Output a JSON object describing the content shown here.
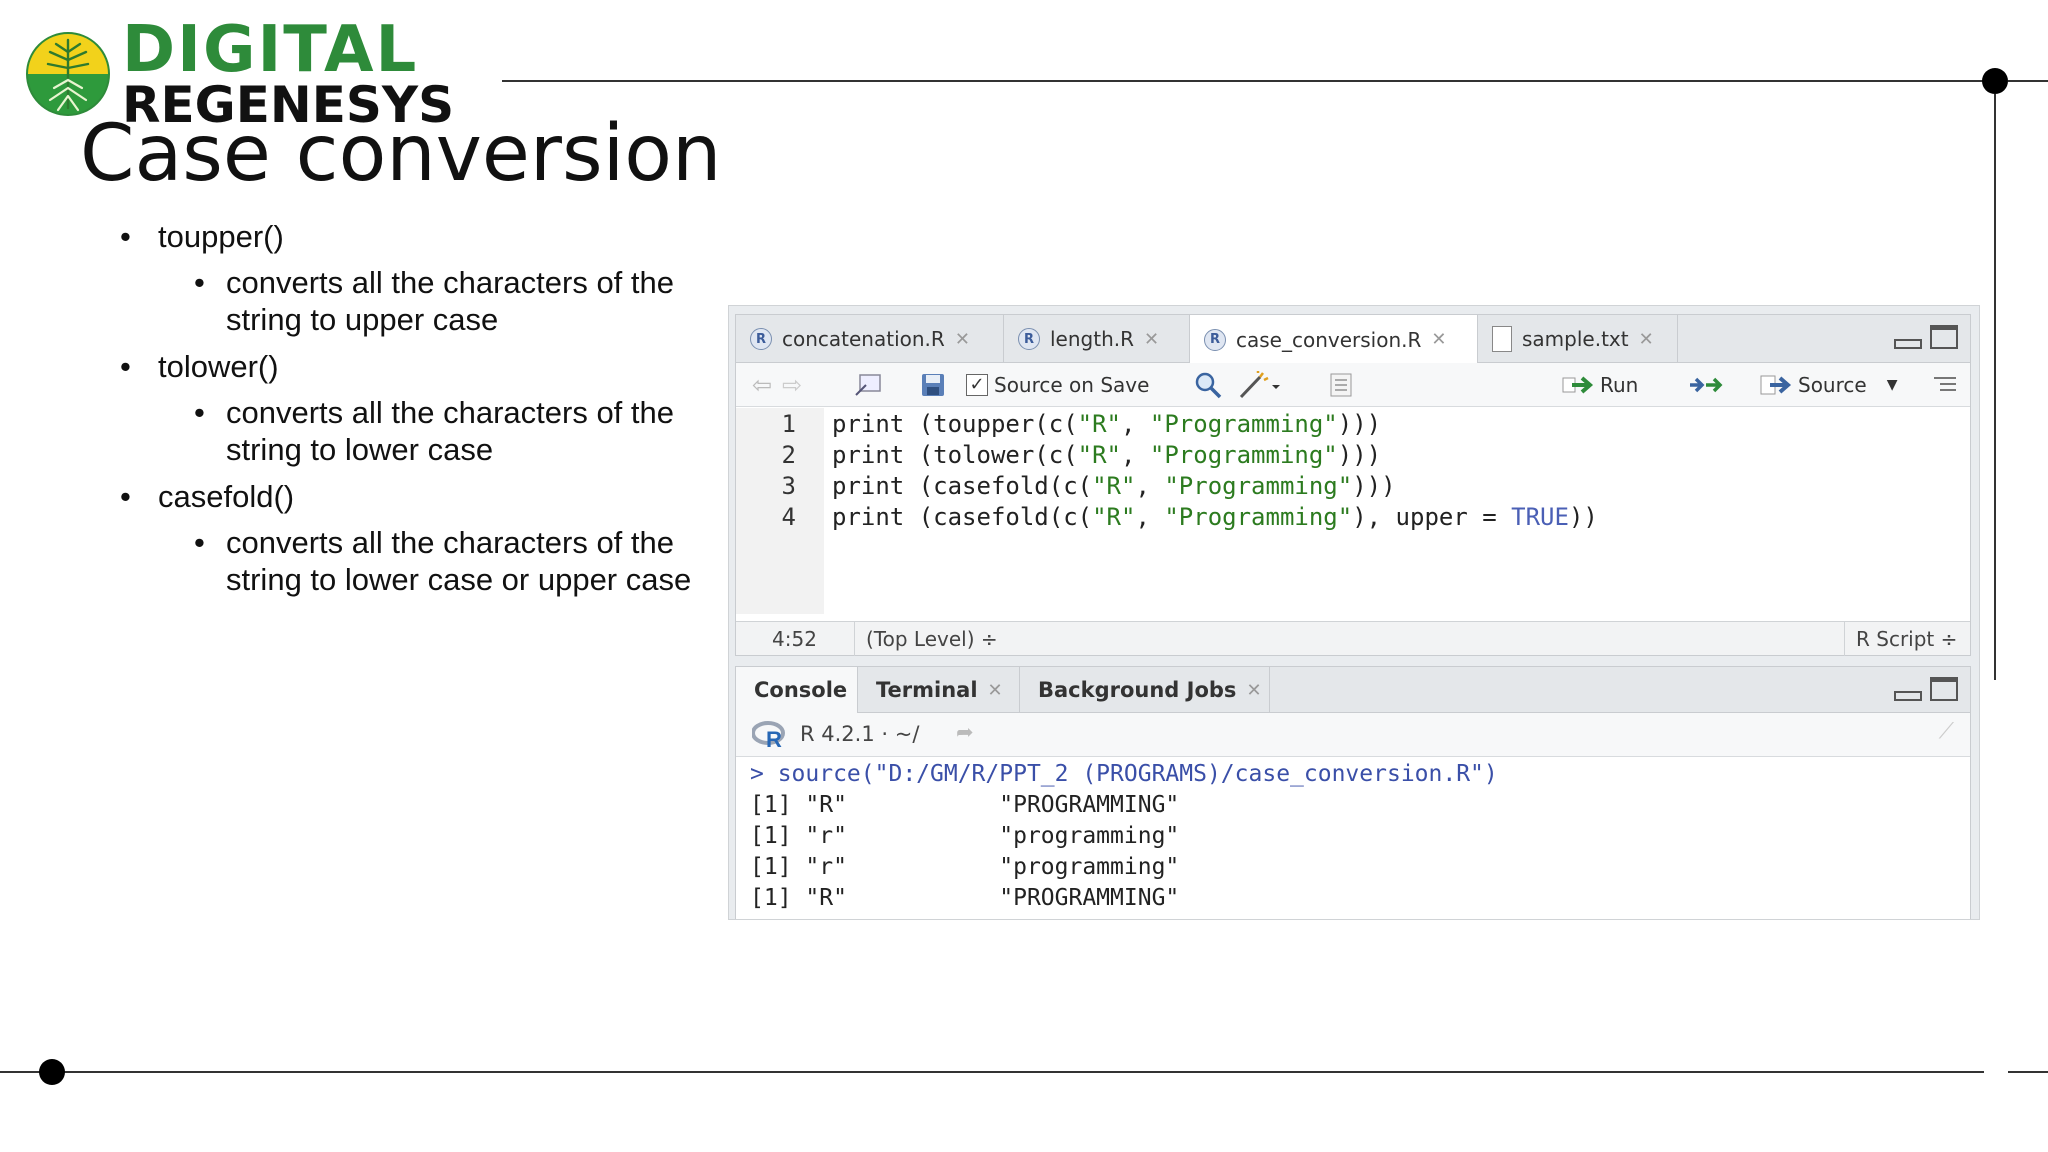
{
  "brand": {
    "line1": "DIGITAL",
    "line2": "REGENESYS",
    "green": "#2e8b3a",
    "yellow": "#f2d21b"
  },
  "slide": {
    "title": "Case conversion",
    "bullets": [
      {
        "label": "toupper()",
        "detail": "converts all the characters of the string to upper case"
      },
      {
        "label": "tolower()",
        "detail": "converts all the characters of the string to lower case"
      },
      {
        "label": "casefold()",
        "detail": "converts all the characters of the string to lower case or upper  case"
      }
    ]
  },
  "rstudio": {
    "source_tabs": [
      {
        "label": "concatenation.R",
        "icon": "r-file-icon"
      },
      {
        "label": "length.R",
        "icon": "r-file-icon"
      },
      {
        "label": "case_conversion.R",
        "icon": "r-file-icon",
        "active": true
      },
      {
        "label": "sample.txt",
        "icon": "text-file-icon"
      }
    ],
    "toolbar": {
      "source_on_save": "Source on Save",
      "run": "Run",
      "source": "Source"
    },
    "code": {
      "line_numbers": [
        "1",
        "2",
        "3",
        "4"
      ],
      "lines": [
        [
          "print (toupper(c(",
          "\"R\"",
          ", ",
          "\"Programming\"",
          ")))"
        ],
        [
          "print (tolower(c(",
          "\"R\"",
          ", ",
          "\"Programming\"",
          ")))"
        ],
        [
          "print (casefold(c(",
          "\"R\"",
          ", ",
          "\"Programming\"",
          ")))"
        ],
        [
          "print (casefold(c(",
          "\"R\"",
          ", ",
          "\"Programming\"",
          "), upper = ",
          "TRUE",
          "))"
        ]
      ]
    },
    "status": {
      "position": "4:52",
      "scope": "(Top Level) ÷",
      "filetype": "R Script ÷"
    },
    "console_tabs": [
      "Console",
      "Terminal",
      "Background Jobs"
    ],
    "console_info": "R 4.2.1 · ~/",
    "console_command": "> source(\"D:/GM/R/PPT_2 (PROGRAMS)/case_conversion.R\")",
    "console_output": [
      "[1] \"R\"           \"PROGRAMMING\"",
      "[1] \"r\"           \"programming\"",
      "[1] \"r\"           \"programming\"",
      "[1] \"R\"           \"PROGRAMMING\""
    ]
  }
}
